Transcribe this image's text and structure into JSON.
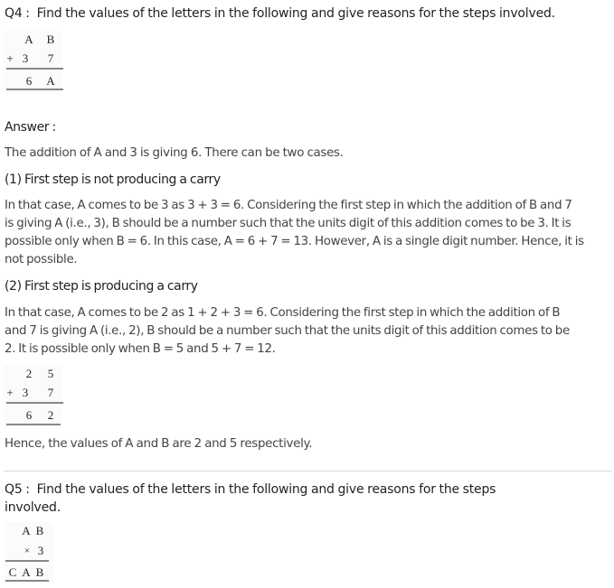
{
  "q4": {
    "label": "Q4 :",
    "question": "Find the values of the letters in the following and give reasons for the steps involved.",
    "problem": {
      "row1": [
        "A",
        "B"
      ],
      "row2_operator": "+",
      "row2": [
        "3",
        "7"
      ],
      "result": [
        "6",
        "A"
      ]
    },
    "answer_label": "Answer :",
    "intro": "The addition of A and 3 is giving 6. There can be two cases.",
    "case1": {
      "heading": "(1) First step is not producing a carry",
      "lines": [
        "In that case, A comes to be 3 as 3 + 3 = 6. Considering the first step in which the addition of B and 7",
        "is giving A (i.e., 3), B should be a number such that the units digit of this addition comes to be 3. It is",
        "possible only when B = 6. In this case, A = 6 + 7 = 13. However, A is a single digit number. Hence, it is",
        "not possible."
      ]
    },
    "case2": {
      "heading": "(2) First step is producing a carry",
      "lines": [
        "In that case, A comes to be 2 as 1 + 2 + 3 = 6. Considering the first step in which the addition of B",
        "and 7 is giving A (i.e., 2), B should be a number such that the units digit of this addition comes to be",
        "2. It is possible only when B = 5 and 5 + 7 = 12."
      ]
    },
    "solution": {
      "row1": [
        "2",
        "5"
      ],
      "row2_operator": "+",
      "row2": [
        "3",
        "7"
      ],
      "result": [
        "6",
        "2"
      ]
    },
    "conclusion": "Hence, the values of A and B are 2 and 5 respectively."
  },
  "q5": {
    "label": "Q5 :",
    "question_lines": [
      "Find the values of the letters in the following and give reasons for the steps",
      "involved."
    ],
    "problem": {
      "row1": [
        "A",
        "B"
      ],
      "row2_operator": "×",
      "row2": [
        "3"
      ],
      "result": [
        "C",
        "A",
        "B"
      ]
    }
  }
}
